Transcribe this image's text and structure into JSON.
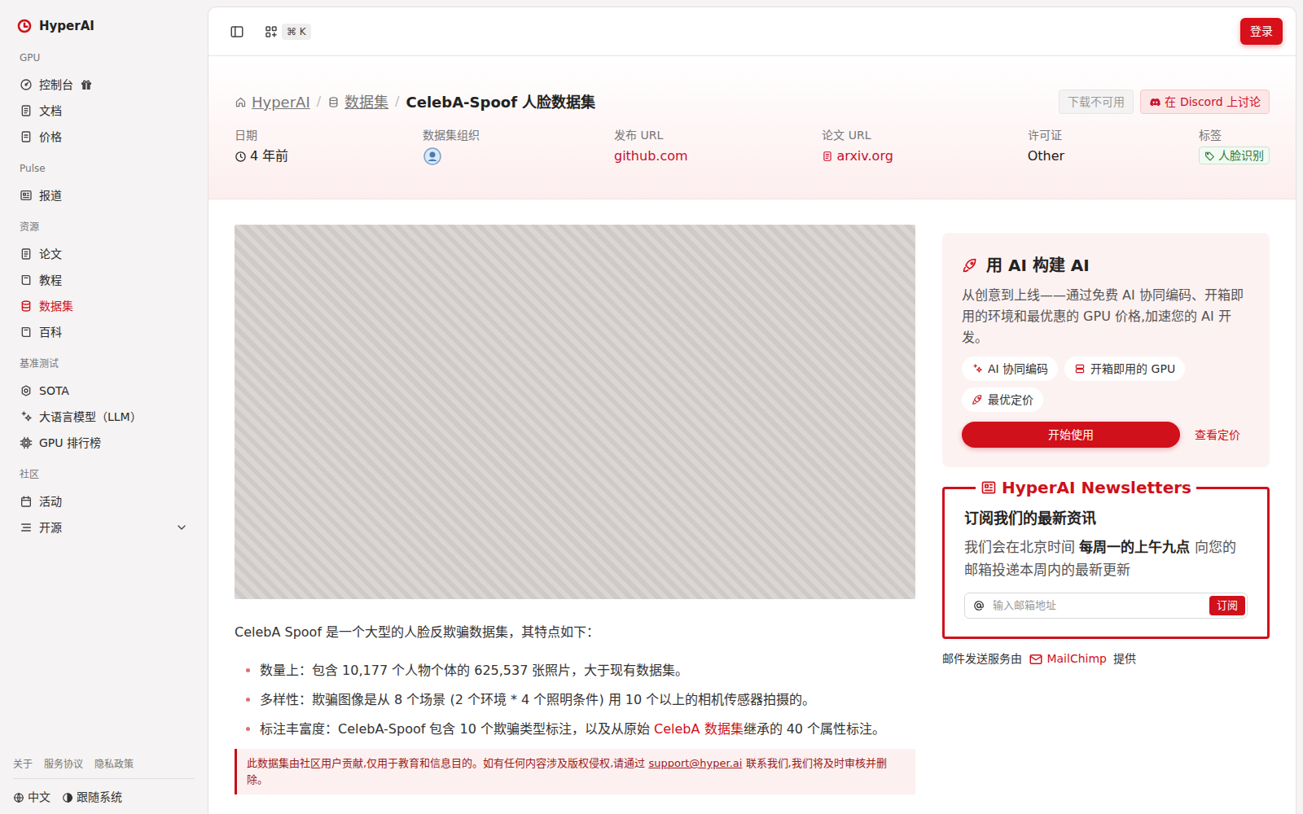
{
  "sidebar": {
    "brand": "HyperAI",
    "sections": [
      {
        "title": "GPU",
        "items": [
          {
            "label": "控制台",
            "selected": false,
            "gift": true
          },
          {
            "label": "文档",
            "selected": false,
            "gift": false
          },
          {
            "label": "价格",
            "selected": false,
            "gift": false
          }
        ]
      },
      {
        "title": "Pulse",
        "items": [
          {
            "label": "报道",
            "selected": false,
            "gift": false
          }
        ]
      },
      {
        "title": "资源",
        "items": [
          {
            "label": "论文",
            "selected": false,
            "gift": false
          },
          {
            "label": "教程",
            "selected": false,
            "gift": false
          },
          {
            "label": "数据集",
            "selected": true,
            "gift": false
          },
          {
            "label": "百科",
            "selected": false,
            "gift": false
          }
        ]
      },
      {
        "title": "基准测试",
        "items": [
          {
            "label": "SOTA",
            "selected": false,
            "gift": false
          },
          {
            "label": "大语言模型（LLM）",
            "selected": false,
            "gift": false
          },
          {
            "label": "GPU 排行榜",
            "selected": false,
            "gift": false
          }
        ]
      },
      {
        "title": "社区",
        "items": [
          {
            "label": "活动",
            "selected": false,
            "gift": false
          },
          {
            "label": "开源",
            "selected": false,
            "gift": false,
            "expanded": false
          }
        ]
      }
    ],
    "footer_links": [
      "关于",
      "服务协议",
      "隐私政策"
    ],
    "language": "中文",
    "theme": "跟随系统"
  },
  "topbar": {
    "shortcut": "⌘ K",
    "login": "登录"
  },
  "header": {
    "breadcrumb": [
      {
        "label": "HyperAI",
        "current": false
      },
      {
        "label": "数据集",
        "current": false
      },
      {
        "label": "CelebA-Spoof 人脸数据集",
        "current": true
      }
    ],
    "separator": "/",
    "actions": [
      {
        "label": "下载不可用",
        "disabled": true
      },
      {
        "label": "在 Discord 上讨论",
        "disabled": false
      }
    ],
    "meta": [
      {
        "label": "日期",
        "value": "4 年前",
        "kind": "time"
      },
      {
        "label": "数据集组织",
        "kind": "avatar"
      },
      {
        "label": "发布 URL",
        "value": "github.com",
        "kind": "link"
      },
      {
        "label": "论文 URL",
        "value": "arxiv.org",
        "kind": "doclink"
      },
      {
        "label": "许可证",
        "value": "Other",
        "kind": "text"
      },
      {
        "label": "标签",
        "value": "人脸识别",
        "kind": "tag"
      }
    ]
  },
  "content": {
    "intro": "CelebA Spoof 是一个大型的人脸反欺骗数据集，其特点如下：",
    "bullets": [
      [
        {
          "text": "数量上：包含 10,177 个人物个体的 625,537 张照片，大于现有数据集。",
          "kind": "text"
        }
      ],
      [
        {
          "text": "多样性：欺骗图像是从 8 个场景 (2 个环境 * 4 个照明条件) 用 10 个以上的相机传感器拍摄的。",
          "kind": "text"
        }
      ],
      [
        {
          "text": "标注丰富度：CelebA-Spoof 包含 10 个欺骗类型标注，以及从原始 ",
          "kind": "text"
        },
        {
          "text": "CelebA 数据集",
          "kind": "link"
        },
        {
          "text": "继承的 40 个属性标注。",
          "kind": "text"
        }
      ]
    ],
    "notice": [
      {
        "text": "此数据集由社区用户贡献,仅用于教育和信息目的。如有任何内容涉及版权侵权,请通过 ",
        "kind": "text"
      },
      {
        "text": "support@hyper.ai",
        "kind": "link"
      },
      {
        "text": " 联系我们,我们将及时审核并删除。",
        "kind": "text"
      }
    ]
  },
  "promo": {
    "title": "用 AI 构建 AI",
    "description": "从创意到上线——通过免费 AI 协同编码、开箱即用的环境和最优惠的 GPU 价格,加速您的 AI 开发。",
    "chips": [
      "AI 协同编码",
      "开箱即用的 GPU",
      "最优定价"
    ],
    "primary": "开始使用",
    "secondary": "查看定价"
  },
  "newsletter": {
    "title": "HyperAI Newsletters",
    "heading": "订阅我们的最新资讯",
    "description": [
      {
        "text": "我们会在北京时间 ",
        "kind": "text"
      },
      {
        "text": "每周一的上午九点",
        "kind": "bold"
      },
      {
        "text": " 向您的邮箱投递本周内的最新更新",
        "kind": "text"
      }
    ],
    "placeholder": "输入邮箱地址",
    "button": "订阅",
    "footer": [
      {
        "text": "邮件发送服务由 ",
        "kind": "text"
      },
      {
        "text": "MailChimp",
        "kind": "link"
      },
      {
        "text": " 提供",
        "kind": "text"
      }
    ]
  }
}
